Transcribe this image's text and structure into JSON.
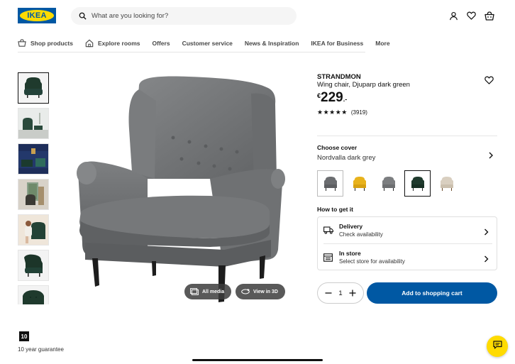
{
  "brand": {
    "logo_text": "IKEA",
    "primary_color": "#0058a3",
    "accent_color": "#ffdb00"
  },
  "search": {
    "placeholder": "What are you looking for?"
  },
  "header_icons": [
    "user-icon",
    "heart-icon",
    "shopping-bag-icon"
  ],
  "nav": {
    "items": [
      {
        "label": "Shop products",
        "icon": "shopping-bag-icon"
      },
      {
        "label": "Explore rooms",
        "icon": "home-icon"
      },
      {
        "label": "Offers"
      },
      {
        "label": "Customer service"
      },
      {
        "label": "News & Inspiration"
      },
      {
        "label": "IKEA for Business"
      },
      {
        "label": "More"
      }
    ]
  },
  "gallery": {
    "thumbnail_count": 7,
    "all_media_label": "All media",
    "view_3d_label": "View in 3D"
  },
  "product": {
    "name": "STRANDMON",
    "description": "Wing chair, Djuparp dark green",
    "currency": "€",
    "price": "229",
    "price_suffix": ".-",
    "rating": 4.5,
    "rating_stars": "★★★★★",
    "review_count": "(3919)"
  },
  "cover": {
    "title": "Choose cover",
    "selected": "Nordvalla dark grey",
    "swatch_colors": [
      "#6b6d70",
      "#e8b21c",
      "#7c7e80",
      "#1f3a2d",
      "#d9cfc0"
    ]
  },
  "delivery": {
    "title": "How to get it",
    "options": [
      {
        "title": "Delivery",
        "subtitle": "Check availability",
        "icon": "truck-icon"
      },
      {
        "title": "In store",
        "subtitle": "Select store for availability",
        "icon": "store-icon"
      }
    ]
  },
  "quantity": {
    "value": "1"
  },
  "cart": {
    "label": "Add to shopping cart"
  },
  "guarantee": {
    "badge": "10",
    "text": "10 year guarantee"
  }
}
